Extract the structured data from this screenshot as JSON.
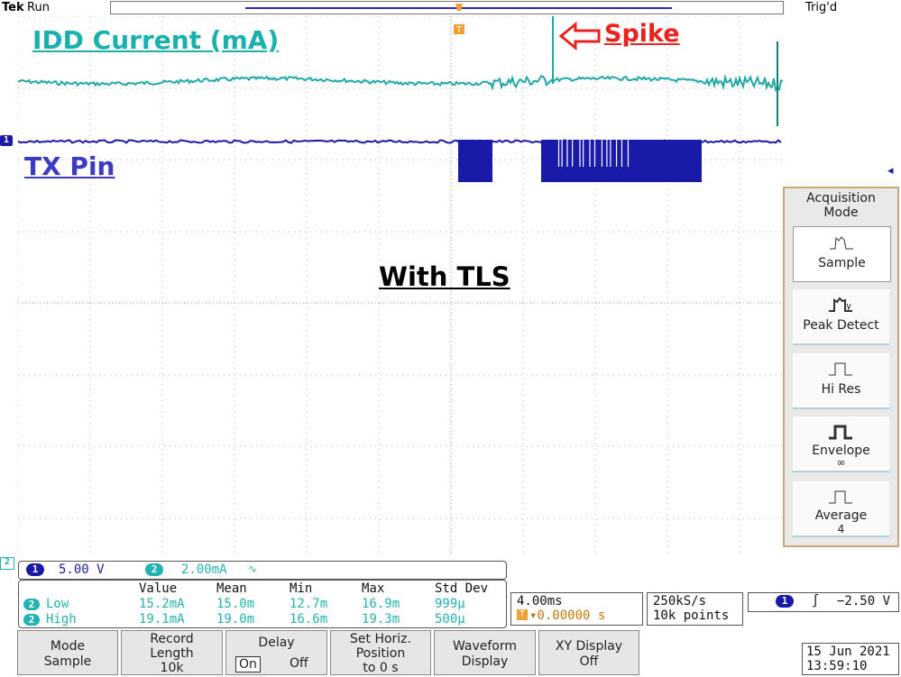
{
  "header": {
    "brand": "Tek",
    "run_state": "Run",
    "trigger_state": "Trig'd"
  },
  "annotations": {
    "idd_label": "IDD Current (mA)",
    "tx_label": "TX Pin",
    "spike_label": "Spike",
    "center_label": "With TLS"
  },
  "markers": {
    "trigger": "T",
    "ch1": "1",
    "ch2": "2"
  },
  "acquisition_menu": {
    "title_line1": "Acquisition",
    "title_line2": "Mode",
    "items": [
      {
        "label": "Sample",
        "sub": "",
        "icon": "sample-waveform-icon"
      },
      {
        "label": "Peak Detect",
        "sub": "",
        "icon": "peak-detect-icon"
      },
      {
        "label": "Hi Res",
        "sub": "",
        "icon": "hi-res-pulse-icon"
      },
      {
        "label": "Envelope",
        "sub": "∞",
        "icon": "envelope-pulse-icon"
      },
      {
        "label": "Average",
        "sub": "4",
        "icon": "average-pulse-icon"
      }
    ]
  },
  "scale": {
    "ch1_num": "1",
    "ch1_scale": "5.00 V",
    "ch2_num": "2",
    "ch2_scale": "2.00mA",
    "ch2_bw_symbol": "∿"
  },
  "measurements": {
    "headers": [
      "Value",
      "Mean",
      "Min",
      "Max",
      "Std Dev"
    ],
    "rows": [
      {
        "ch": "2",
        "name": "Low",
        "value": "15.2mA",
        "mean": "15.0m",
        "min": "12.7m",
        "max": "16.9m",
        "std": "999µ"
      },
      {
        "ch": "2",
        "name": "High",
        "value": "19.1mA",
        "mean": "19.0m",
        "min": "16.6m",
        "max": "19.3m",
        "std": "500µ"
      }
    ]
  },
  "horizontal": {
    "timebase": "4.00ms",
    "position": "▾0.00000 s"
  },
  "sampling": {
    "rate": "250kS/s",
    "points": "10k points"
  },
  "trigger": {
    "ch": "1",
    "slope": "∫",
    "level": "−2.50 V"
  },
  "softkeys": [
    {
      "line1": "Mode",
      "line2": "Sample",
      "line3": ""
    },
    {
      "line1": "Record",
      "line2": "Length",
      "line3": "10k"
    },
    {
      "line1": "Delay",
      "line2": "",
      "line3": ""
    },
    {
      "line1": "Set Horiz.",
      "line2": "Position",
      "line3": "to 0 s"
    },
    {
      "line1": "Waveform",
      "line2": "Display",
      "line3": ""
    },
    {
      "line1": "XY Display",
      "line2": "Off",
      "line3": ""
    }
  ],
  "delay": {
    "on": "On",
    "off": "Off"
  },
  "datetime": {
    "date": "15 Jun 2021",
    "time": "13:59:10"
  },
  "colors": {
    "ch1": "#1a1aa8",
    "ch2": "#1fa8a5",
    "spike": "#e8231f",
    "menu_border": "#c9a878"
  }
}
